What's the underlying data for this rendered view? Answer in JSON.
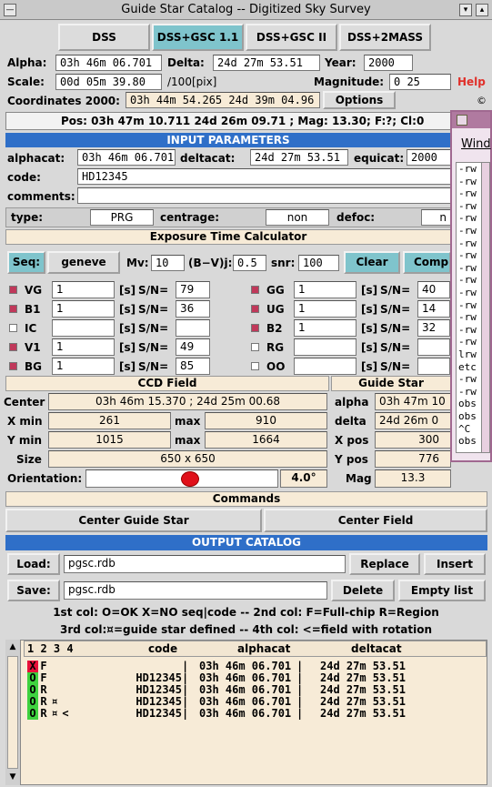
{
  "window": {
    "title": "Guide Star Catalog -- Digitized Sky Survey"
  },
  "survey_tabs": [
    "DSS",
    "DSS+GSC 1.1",
    "DSS+GSC II",
    "DSS+2MASS"
  ],
  "survey_active": 1,
  "coords": {
    "alpha_label": "Alpha:",
    "alpha": "03h 46m 06.701",
    "delta_label": "Delta:",
    "delta": "24d 27m 53.51",
    "year_label": "Year:",
    "year": "2000",
    "scale_label": "Scale:",
    "scale": "00d 05m 39.80",
    "scale_unit": "/100[pix]",
    "magnitude_label": "Magnitude:",
    "magnitude": "0 25",
    "help": "Help",
    "coords2000_label": "Coordinates 2000:",
    "coords2000": "03h 44m 54.265  24d 39m 04.96",
    "options": "Options",
    "copyright": "©"
  },
  "status_line": "Pos: 03h 47m 10.711  24d 26m 09.71 ; Mag: 13.30; F:?; Cl:0",
  "input": {
    "header": "INPUT PARAMETERS",
    "alphacat_label": "alphacat:",
    "alphacat": "03h 46m 06.701",
    "deltacat_label": "deltacat:",
    "deltacat": "24d 27m 53.51",
    "equicat_label": "equicat:",
    "equicat": "2000",
    "code_label": "code:",
    "code": "HD12345",
    "comments_label": "comments:",
    "comments": "",
    "type_label": "type:",
    "type": "PRG",
    "centrage_label": "centrage:",
    "centrage": "non",
    "defoc_label": "defoc:",
    "defoc": "n"
  },
  "etc": {
    "header": "Exposure Time Calculator",
    "seq": "Seq:",
    "seq_value": "geneve",
    "mv_label": "Mv:",
    "mv": "10",
    "bv_label": "(B−V)j:",
    "bv": "0.5",
    "snr_label": "snr:",
    "snr": "100",
    "clear": "Clear",
    "comp": "Comp",
    "unit": "[s]",
    "sn": "S/N=",
    "left_filters": [
      {
        "name": "VG",
        "on": true,
        "t": "1",
        "sn": "79"
      },
      {
        "name": "B1",
        "on": true,
        "t": "1",
        "sn": "36"
      },
      {
        "name": "IC",
        "on": false,
        "t": "",
        "sn": ""
      },
      {
        "name": "V1",
        "on": true,
        "t": "1",
        "sn": "49"
      },
      {
        "name": "BG",
        "on": true,
        "t": "1",
        "sn": "85"
      }
    ],
    "right_filters": [
      {
        "name": "GG",
        "on": true,
        "t": "1",
        "sn": "40"
      },
      {
        "name": "UG",
        "on": true,
        "t": "1",
        "sn": "14"
      },
      {
        "name": "B2",
        "on": true,
        "t": "1",
        "sn": "32"
      },
      {
        "name": "RG",
        "on": false,
        "t": "",
        "sn": ""
      },
      {
        "name": "OO",
        "on": false,
        "t": "",
        "sn": ""
      }
    ]
  },
  "ccd": {
    "header": "CCD Field",
    "center_label": "Center",
    "center": "03h 46m 15.370 ;  24d 25m 00.68",
    "xmin_label": "X min",
    "xmin": "261",
    "max_label": "max",
    "xmax": "910",
    "ymin_label": "Y min",
    "ymin": "1015",
    "ymax": "1664",
    "size_label": "Size",
    "size": "650 x 650",
    "orientation_label": "Orientation:",
    "orientation": "4.0°"
  },
  "guide": {
    "header": "Guide Star",
    "alpha_label": "alpha",
    "alpha": "03h 47m 10",
    "delta_label": "delta",
    "delta": "24d 26m 0",
    "xpos_label": "X pos",
    "xpos": "300",
    "ypos_label": "Y pos",
    "ypos": "776",
    "mag_label": "Mag",
    "mag": "13.3"
  },
  "commands": {
    "header": "Commands",
    "center_guide": "Center Guide Star",
    "center_field": "Center Field"
  },
  "output": {
    "header": "OUTPUT CATALOG",
    "load": "Load:",
    "load_file": "pgsc.rdb",
    "replace": "Replace",
    "insert": "Insert",
    "save": "Save:",
    "save_file": "pgsc.rdb",
    "delete": "Delete",
    "empty": "Empty list",
    "legend1": "1st col: O=OK X=NO seq|code  --  2nd col: F=Full-chip R=Region",
    "legend2": "3rd col:¤=guide star defined  --  4th col: <=field with rotation",
    "columns": {
      "flags": "1 2 3 4",
      "code": "code",
      "alphacat": "alphacat",
      "deltacat": "deltacat"
    },
    "rows": [
      {
        "c1": "X",
        "c2": "F",
        "c3": " ",
        "c4": " ",
        "code": "",
        "alpha": "03h 46m 06.701",
        "delta": "24d 27m 53.51"
      },
      {
        "c1": "O",
        "c2": "F",
        "c3": " ",
        "c4": " ",
        "code": "HD12345",
        "alpha": "03h 46m 06.701",
        "delta": "24d 27m 53.51"
      },
      {
        "c1": "O",
        "c2": "R",
        "c3": " ",
        "c4": " ",
        "code": "HD12345",
        "alpha": "03h 46m 06.701",
        "delta": "24d 27m 53.51"
      },
      {
        "c1": "O",
        "c2": "R",
        "c3": "¤",
        "c4": " ",
        "code": "HD12345",
        "alpha": "03h 46m 06.701",
        "delta": "24d 27m 53.51"
      },
      {
        "c1": "O",
        "c2": "R",
        "c3": "¤",
        "c4": "<",
        "code": "HD12345",
        "alpha": "03h 46m 06.701",
        "delta": "24d 27m 53.51"
      }
    ]
  },
  "side_window": {
    "title": "Wind",
    "lines": [
      "-rw",
      "-rw",
      "-rw",
      "-rw",
      "-rw",
      "-rw",
      "-rw",
      "-rw",
      "-rw",
      "-rw",
      "-rw",
      "-rw",
      "-rw",
      "-rw",
      "-rw",
      "lrw",
      "etc",
      "-rw",
      "-rw",
      "obs",
      "obs",
      "^C",
      "obs"
    ]
  }
}
